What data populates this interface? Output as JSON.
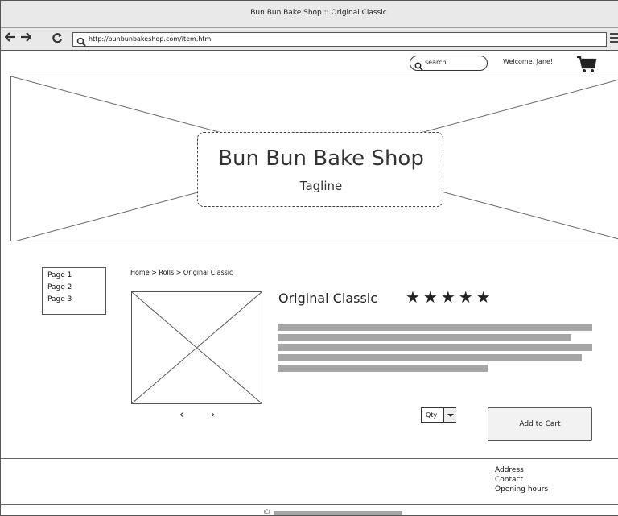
{
  "window": {
    "title": "Bun Bun Bake Shop :: Original Classic"
  },
  "browser": {
    "back_glyph": "🡐",
    "forward_glyph": "🡒",
    "reload_glyph": "C",
    "url": "http://bunbunbakeshop.com/item.html"
  },
  "header": {
    "search_placeholder": "search",
    "welcome": "Welcome, Jane!"
  },
  "hero": {
    "title": "Bun Bun Bake Shop",
    "tagline": "Tagline"
  },
  "sidenav": {
    "items": [
      "Page 1",
      "Page 2",
      "Page 3"
    ]
  },
  "breadcrumb": "Home > Rolls > Original Classic",
  "product": {
    "name": "Original Classic",
    "stars": "★★★★★",
    "rating": 5,
    "prev_glyph": "‹",
    "next_glyph": "›",
    "qty_label": "Qty",
    "add_to_cart": "Add to Cart"
  },
  "footer": {
    "links": [
      "Address",
      "Contact",
      "Opening hours"
    ],
    "copyright_symbol": "©"
  },
  "colors": {
    "chrome": "#e9e9e9",
    "placeholder_text_bar": "#a6a6a6",
    "line": "#555555"
  }
}
